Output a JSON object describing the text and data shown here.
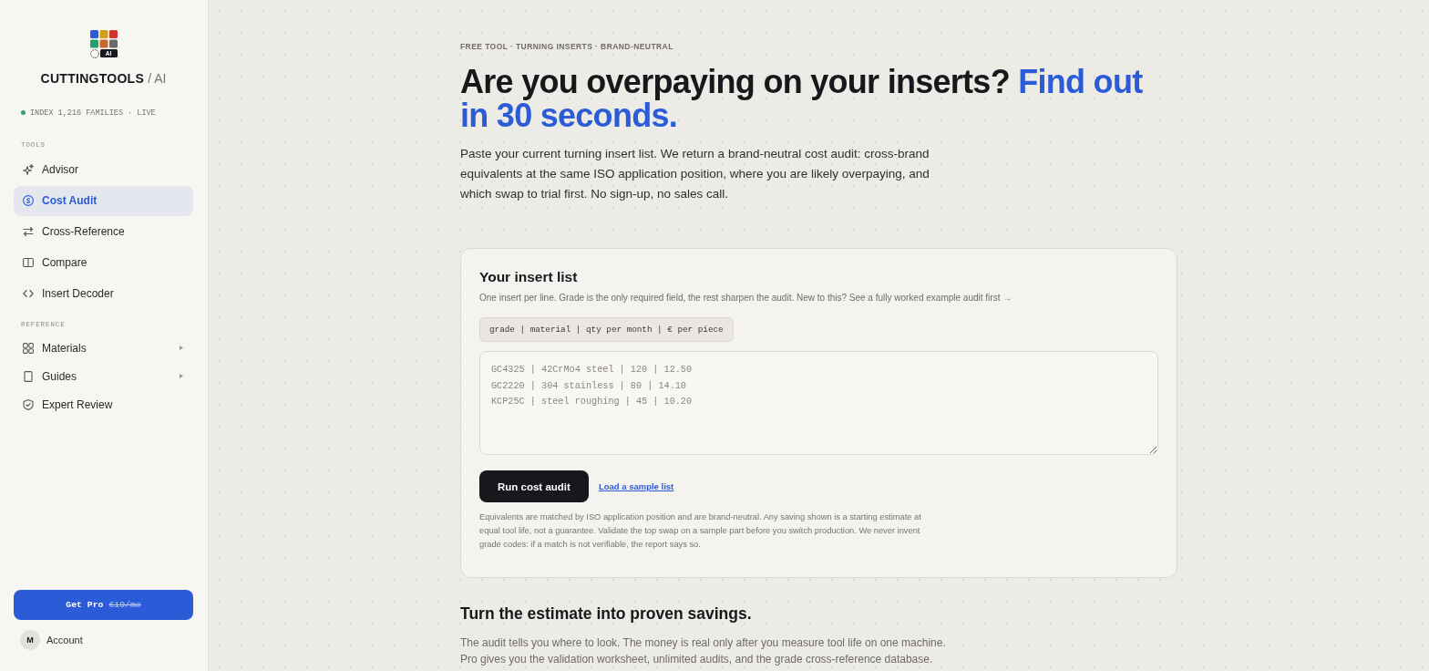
{
  "sidebar": {
    "logo": {
      "badge": "AI",
      "name": "CUTTINGTOOLS",
      "suffix": "/ AI"
    },
    "status": {
      "text": "INDEX 1,216 FAMILIES · LIVE",
      "live": true
    },
    "sections": [
      {
        "label": "TOOLS",
        "items": [
          {
            "label": "Advisor",
            "selected": false,
            "has_submenu": false
          },
          {
            "label": "Cost Audit",
            "selected": true,
            "has_submenu": false
          },
          {
            "label": "Cross-Reference",
            "selected": false,
            "has_submenu": false
          },
          {
            "label": "Compare",
            "selected": false,
            "has_submenu": false
          },
          {
            "label": "Insert Decoder",
            "selected": false,
            "has_submenu": false
          }
        ]
      },
      {
        "label": "REFERENCE",
        "items": [
          {
            "label": "Materials",
            "selected": false,
            "has_submenu": true
          },
          {
            "label": "Guides",
            "selected": false,
            "has_submenu": true
          },
          {
            "label": "Expert Review",
            "selected": false,
            "has_submenu": false
          }
        ]
      }
    ],
    "upgrade_button": {
      "label": "Get Pro",
      "price": "€19/mo"
    },
    "account": {
      "initial": "M",
      "label": "Account"
    }
  },
  "main": {
    "kicker": "FREE TOOL · TURNING INSERTS · BRAND-NEUTRAL",
    "headline": "Are you overpaying on your inserts?",
    "headline_highlight": "Find out in 30 seconds.",
    "intro": "Paste your current turning insert list. We return a brand-neutral cost audit: cross-brand equivalents at the same ISO application position, where you are likely overpaying, and which swap to trial first. No sign-up, no sales call.",
    "card": {
      "title": "Your insert list",
      "help": "One insert per line. Grade is the only required field, the rest sharpen the audit. New to this? See a fully worked example audit first →",
      "format_hint": "grade | material | qty per month | € per piece",
      "input": {
        "placeholder": "GC4325 | 42CrMo4 steel | 120 | 12.50\nGC2220 | 304 stainless | 80 | 14.10\nKCP25C | steel roughing | 45 | 10.20"
      },
      "run_button": "Run cost audit",
      "sample_link": "Load a sample list",
      "disclaimer": "Equivalents are matched by ISO application position and are brand-neutral. Any saving shown is a starting estimate at equal tool life, not a guarantee. Validate the top swap on a sample part before you switch production. We never invent grade codes: if a match is not verifiable, the report says so."
    },
    "next_section": {
      "title": "Turn the estimate into proven savings.",
      "text": "The audit tells you where to look. The money is real only after you measure tool life on one machine. Pro gives you the validation worksheet, unlimited audits, and the grade cross-reference database."
    }
  }
}
